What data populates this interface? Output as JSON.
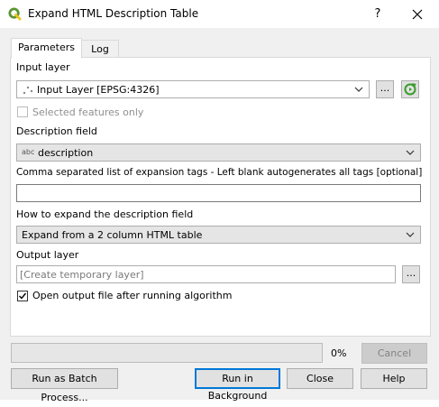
{
  "window": {
    "title": "Expand HTML Description Table",
    "help_label": "?"
  },
  "tabs": [
    {
      "label": "Parameters",
      "active": true
    },
    {
      "label": "Log",
      "active": false
    }
  ],
  "params": {
    "input_layer_label": "Input layer",
    "input_layer_value": "Input Layer [EPSG:4326]",
    "browse_label": "...",
    "selected_features_label": "Selected features only",
    "description_field_label": "Description field",
    "description_field_type_icon": "abc",
    "description_field_value": "description",
    "expansion_tags_label": "Comma separated list of expansion tags - Left blank autogenerates all tags [optional]",
    "expansion_tags_value": "",
    "expand_method_label": "How to expand the description field",
    "expand_method_value": "Expand from a 2 column HTML table",
    "output_layer_label": "Output layer",
    "output_layer_placeholder": "[Create temporary layer]",
    "output_browse_label": "...",
    "open_output_label": "Open output file after running algorithm",
    "open_output_checked": true,
    "selected_features_checked": false
  },
  "progress": {
    "value": 0,
    "text": "0%"
  },
  "buttons": {
    "cancel": "Cancel",
    "batch": "Run as Batch Process...",
    "run_background": "Run in Background",
    "close": "Close",
    "help": "Help"
  },
  "colors": {
    "accent": "#0078d7",
    "qgis_green": "#589632",
    "qgis_yellow": "#f0c419"
  }
}
